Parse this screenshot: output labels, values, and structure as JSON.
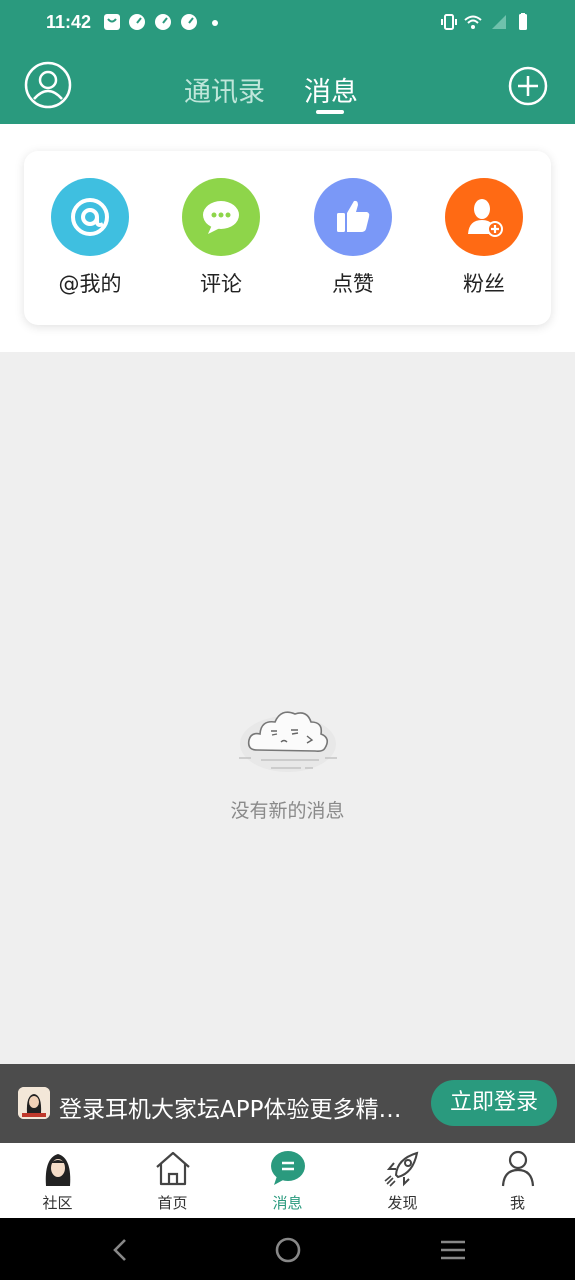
{
  "status_bar": {
    "time": "11:42"
  },
  "header": {
    "tabs": [
      {
        "label": "通讯录"
      },
      {
        "label": "消息"
      }
    ]
  },
  "shortcuts": [
    {
      "label": "@我的",
      "icon": "at-icon",
      "color": "#3fbfe0"
    },
    {
      "label": "评论",
      "icon": "comment-icon",
      "color": "#8ed54a"
    },
    {
      "label": "点赞",
      "icon": "thumbs-up-icon",
      "color": "#7a98f7"
    },
    {
      "label": "粉丝",
      "icon": "fans-icon",
      "color": "#ff6a14"
    }
  ],
  "empty_state": {
    "text": "没有新的消息"
  },
  "login_banner": {
    "text": "登录耳机大家坛APP体验更多精彩内容",
    "button": "立即登录"
  },
  "bottom_nav": [
    {
      "label": "社区",
      "icon": "community-icon"
    },
    {
      "label": "首页",
      "icon": "home-icon"
    },
    {
      "label": "消息",
      "icon": "message-icon",
      "active": true
    },
    {
      "label": "发现",
      "icon": "rocket-icon"
    },
    {
      "label": "我",
      "icon": "profile-icon"
    }
  ],
  "colors": {
    "brand": "#2a9a7e",
    "active_tab": "#ffffff",
    "inactive_tab": "#bfe6da"
  }
}
